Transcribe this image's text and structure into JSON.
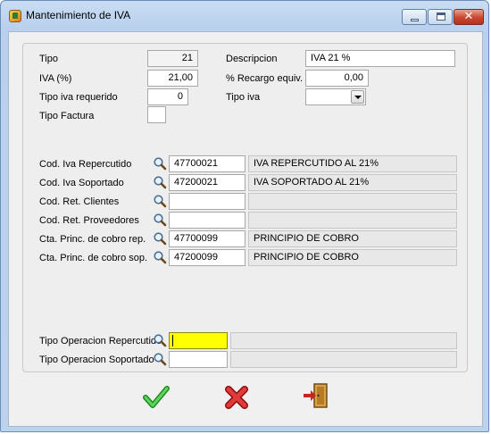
{
  "window": {
    "title": "Mantenimiento de IVA",
    "controls": {
      "minimize": "minimize",
      "maximize": "maximize",
      "close": "✕"
    }
  },
  "form": {
    "tipo": {
      "label": "Tipo",
      "value": "21"
    },
    "descripcion": {
      "label": "Descripcion",
      "value": "IVA 21 %"
    },
    "iva_pct": {
      "label": "IVA (%)",
      "value": "21,00"
    },
    "recargo": {
      "label": "% Recargo equiv.",
      "value": "0,00"
    },
    "tipo_iva_requerido": {
      "label": "Tipo iva requerido",
      "value": "0"
    },
    "tipo_iva": {
      "label": "Tipo iva",
      "value": ""
    },
    "tipo_factura": {
      "label": "Tipo Factura",
      "value": ""
    }
  },
  "accounts": [
    {
      "label": "Cod. Iva Repercutido",
      "code": "47700021",
      "description": "IVA REPERCUTIDO AL 21%"
    },
    {
      "label": "Cod. Iva Soportado",
      "code": "47200021",
      "description": "IVA SOPORTADO AL 21%"
    },
    {
      "label": "Cod. Ret. Clientes",
      "code": "",
      "description": ""
    },
    {
      "label": "Cod. Ret. Proveedores",
      "code": "",
      "description": ""
    },
    {
      "label": "Cta. Princ. de cobro  rep.",
      "code": "47700099",
      "description": "PRINCIPIO DE COBRO"
    },
    {
      "label": "Cta. Princ. de cobro  sop.",
      "code": "47200099",
      "description": "PRINCIPIO DE COBRO"
    }
  ],
  "operations": [
    {
      "label": "Tipo Operacion Repercutido",
      "code": "",
      "description": ""
    },
    {
      "label": "Tipo Operacion Soportado",
      "code": "",
      "description": ""
    }
  ],
  "colors": {
    "accept": "#2fb02f",
    "cancel": "#d42020",
    "active_field": "#ffff00"
  },
  "buttons": {
    "accept": "accept-check-icon",
    "cancel": "cancel-x-icon",
    "exit": "exit-door-icon"
  }
}
